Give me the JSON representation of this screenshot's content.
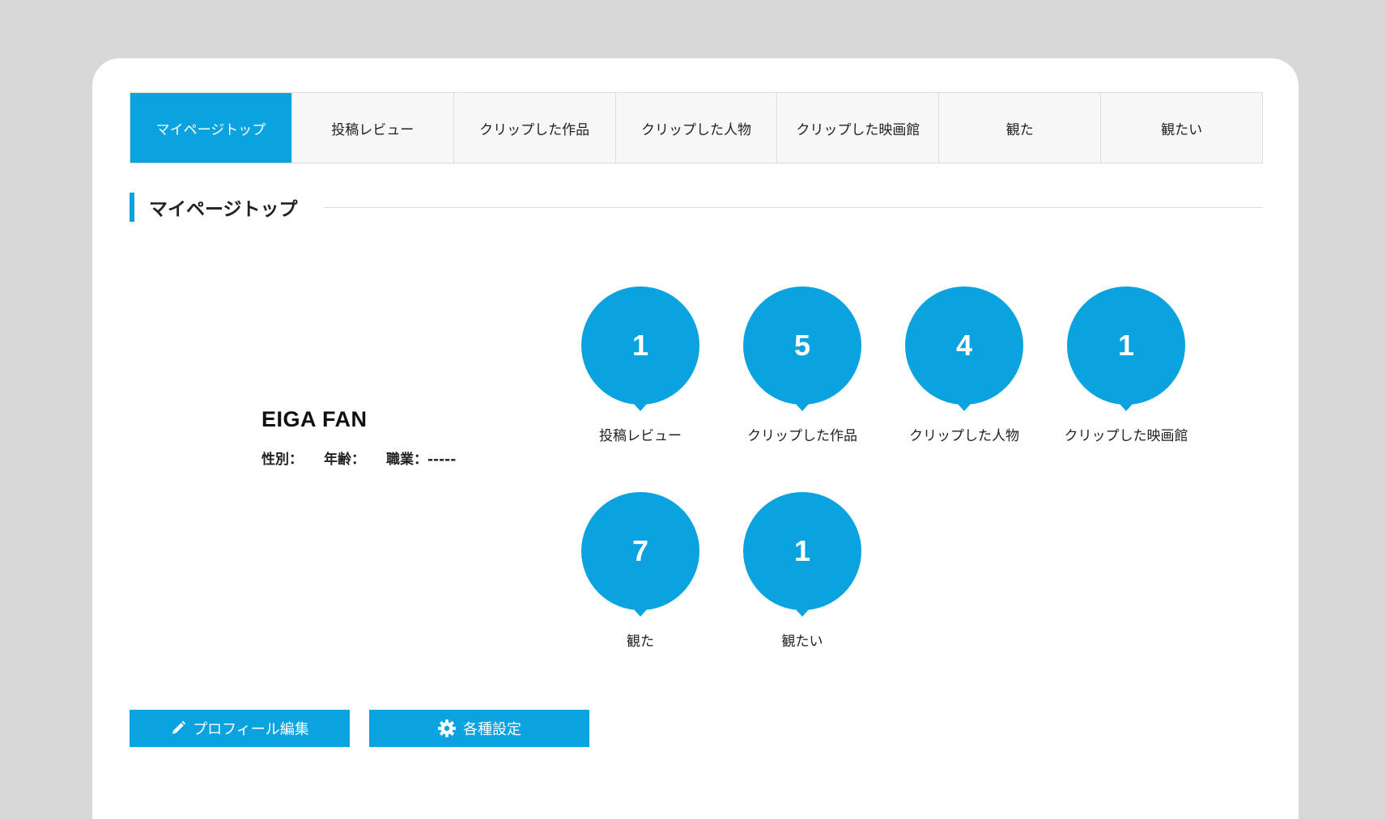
{
  "tabs": [
    {
      "label": "マイページトップ",
      "active": true
    },
    {
      "label": "投稿レビュー",
      "active": false
    },
    {
      "label": "クリップした作品",
      "active": false
    },
    {
      "label": "クリップした人物",
      "active": false
    },
    {
      "label": "クリップした映画館",
      "active": false
    },
    {
      "label": "観た",
      "active": false
    },
    {
      "label": "観たい",
      "active": false
    }
  ],
  "section": {
    "title": "マイページトップ"
  },
  "profile": {
    "name": "EIGA FAN",
    "gender_label": "性別：",
    "gender_value": "",
    "age_label": "年齢：",
    "age_value": "",
    "job_label": "職業：",
    "job_value": "-----"
  },
  "stats": [
    {
      "count": "1",
      "label": "投稿レビュー"
    },
    {
      "count": "5",
      "label": "クリップした作品"
    },
    {
      "count": "4",
      "label": "クリップした人物"
    },
    {
      "count": "1",
      "label": "クリップした映画館"
    },
    {
      "count": "7",
      "label": "観た"
    },
    {
      "count": "1",
      "label": "観たい"
    }
  ],
  "buttons": {
    "edit_profile": "プロフィール編集",
    "settings": "各種設定"
  },
  "colors": {
    "accent": "#0aa3e0",
    "background": "#d8d8d8"
  },
  "icons": {
    "edit": "pencil-icon",
    "settings": "gear-icon"
  }
}
